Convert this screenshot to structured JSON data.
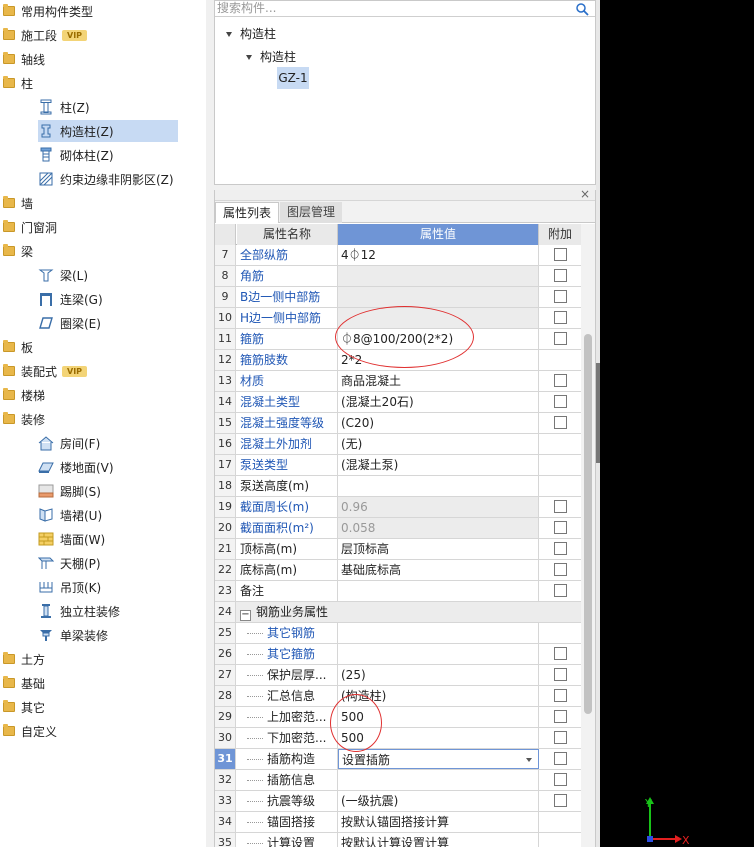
{
  "sidebar": {
    "items": [
      {
        "label": "常用构件类型",
        "type": "folder"
      },
      {
        "label": "施工段",
        "type": "folder",
        "badge": "VIP"
      },
      {
        "label": "轴线",
        "type": "folder"
      },
      {
        "label": "柱",
        "type": "folder"
      },
      {
        "label": "柱(Z)",
        "type": "child",
        "icon": "column-icon"
      },
      {
        "label": "构造柱(Z)",
        "type": "child",
        "icon": "constructional-column-icon",
        "selected": true
      },
      {
        "label": "砌体柱(Z)",
        "type": "child",
        "icon": "masonry-column-icon"
      },
      {
        "label": "约束边缘非阴影区(Z)",
        "type": "child",
        "icon": "hatched-area-icon"
      },
      {
        "label": "墙",
        "type": "folder"
      },
      {
        "label": "门窗洞",
        "type": "folder"
      },
      {
        "label": "梁",
        "type": "folder"
      },
      {
        "label": "梁(L)",
        "type": "child",
        "icon": "beam-icon"
      },
      {
        "label": "连梁(G)",
        "type": "child",
        "icon": "coupling-beam-icon"
      },
      {
        "label": "圈梁(E)",
        "type": "child",
        "icon": "ring-beam-icon"
      },
      {
        "label": "板",
        "type": "folder"
      },
      {
        "label": "装配式",
        "type": "folder",
        "badge": "VIP"
      },
      {
        "label": "楼梯",
        "type": "folder"
      },
      {
        "label": "装修",
        "type": "folder"
      },
      {
        "label": "房间(F)",
        "type": "child",
        "icon": "room-icon"
      },
      {
        "label": "楼地面(V)",
        "type": "child",
        "icon": "floor-icon"
      },
      {
        "label": "踢脚(S)",
        "type": "child",
        "icon": "skirting-icon"
      },
      {
        "label": "墙裙(U)",
        "type": "child",
        "icon": "wainscot-icon"
      },
      {
        "label": "墙面(W)",
        "type": "child",
        "icon": "wall-surface-icon"
      },
      {
        "label": "天棚(P)",
        "type": "child",
        "icon": "ceiling-icon"
      },
      {
        "label": "吊顶(K)",
        "type": "child",
        "icon": "suspended-ceiling-icon"
      },
      {
        "label": "独立柱装修",
        "type": "child",
        "icon": "column-finish-icon"
      },
      {
        "label": "单梁装修",
        "type": "child",
        "icon": "beam-finish-icon"
      },
      {
        "label": "土方",
        "type": "folder"
      },
      {
        "label": "基础",
        "type": "folder"
      },
      {
        "label": "其它",
        "type": "folder"
      },
      {
        "label": "自定义",
        "type": "folder"
      }
    ]
  },
  "component_list": {
    "search_placeholder": "搜索构件...",
    "tree": [
      "构造柱",
      "构造柱",
      "GZ-1"
    ]
  },
  "properties": {
    "tabs": [
      "属性列表",
      "图层管理"
    ],
    "headers": {
      "name": "属性名称",
      "value": "属性值",
      "extra": "附加"
    },
    "rows": [
      {
        "num": "7",
        "name": "全部纵筋",
        "value": "4⏀12",
        "blue": true,
        "check": true
      },
      {
        "num": "8",
        "name": "角筋",
        "value": "",
        "blue": true,
        "gray": true,
        "check": true
      },
      {
        "num": "9",
        "name": "B边一侧中部筋",
        "value": "",
        "blue": true,
        "gray": true,
        "check": true
      },
      {
        "num": "10",
        "name": "H边一侧中部筋",
        "value": "",
        "blue": true,
        "gray": true,
        "check": true
      },
      {
        "num": "11",
        "name": "箍筋",
        "value": "⏀8@100/200(2*2)",
        "blue": true,
        "check": true
      },
      {
        "num": "12",
        "name": "箍筋肢数",
        "value": "2*2",
        "blue": true,
        "check": false
      },
      {
        "num": "13",
        "name": "材质",
        "value": "商品混凝土",
        "blue": true,
        "check": true
      },
      {
        "num": "14",
        "name": "混凝土类型",
        "value": "(混凝土20石)",
        "blue": true,
        "check": true
      },
      {
        "num": "15",
        "name": "混凝土强度等级",
        "value": "(C20)",
        "blue": true,
        "check": true
      },
      {
        "num": "16",
        "name": "混凝土外加剂",
        "value": "(无)",
        "blue": true,
        "check": false
      },
      {
        "num": "17",
        "name": "泵送类型",
        "value": "(混凝土泵)",
        "blue": true,
        "check": false
      },
      {
        "num": "18",
        "name": "泵送高度(m)",
        "value": "",
        "blue": false,
        "check": false
      },
      {
        "num": "19",
        "name": "截面周长(m)",
        "value": "0.96",
        "blue": true,
        "gray": true,
        "check": true
      },
      {
        "num": "20",
        "name": "截面面积(m²)",
        "value": "0.058",
        "blue": true,
        "gray": true,
        "check": true
      },
      {
        "num": "21",
        "name": "顶标高(m)",
        "value": "层顶标高",
        "blue": false,
        "check": true
      },
      {
        "num": "22",
        "name": "底标高(m)",
        "value": "基础底标高",
        "blue": false,
        "check": true
      },
      {
        "num": "23",
        "name": "备注",
        "value": "",
        "blue": false,
        "check": true
      },
      {
        "num": "24",
        "name": "钢筋业务属性",
        "value": "",
        "blue": false,
        "group": true,
        "gray": true,
        "check": false
      },
      {
        "num": "25",
        "name": "其它钢筋",
        "value": "",
        "blue": true,
        "indent": true,
        "check": false
      },
      {
        "num": "26",
        "name": "其它箍筋",
        "value": "",
        "blue": true,
        "indent": true,
        "check": true
      },
      {
        "num": "27",
        "name": "保护层厚...",
        "value": "(25)",
        "blue": false,
        "indent": true,
        "check": true
      },
      {
        "num": "28",
        "name": "汇总信息",
        "value": "(构造柱)",
        "blue": false,
        "indent": true,
        "check": true
      },
      {
        "num": "29",
        "name": "上加密范...",
        "value": "500",
        "blue": false,
        "indent": true,
        "check": true
      },
      {
        "num": "30",
        "name": "下加密范...",
        "value": "500",
        "blue": false,
        "indent": true,
        "check": true
      },
      {
        "num": "31",
        "name": "插筋构造",
        "value": "设置插筋",
        "blue": false,
        "indent": true,
        "active": true,
        "dropdown": true,
        "check": true
      },
      {
        "num": "32",
        "name": "插筋信息",
        "value": "",
        "blue": false,
        "indent": true,
        "check": true
      },
      {
        "num": "33",
        "name": "抗震等级",
        "value": "(一级抗震)",
        "blue": false,
        "indent": true,
        "check": true
      },
      {
        "num": "34",
        "name": "锚固搭接",
        "value": "按默认锚固搭接计算",
        "blue": false,
        "indent": true,
        "check": false
      },
      {
        "num": "35",
        "name": "计算设置",
        "value": "按默认计算设置计算",
        "blue": false,
        "indent": true,
        "check": false
      }
    ]
  },
  "axes": {
    "y": "Y",
    "x": "X"
  },
  "colors": {
    "accent": "#6f95d6",
    "selected": "#c7daf3",
    "link": "#2057b5",
    "folder": "#e8b74a",
    "annotation": "#e03030"
  }
}
